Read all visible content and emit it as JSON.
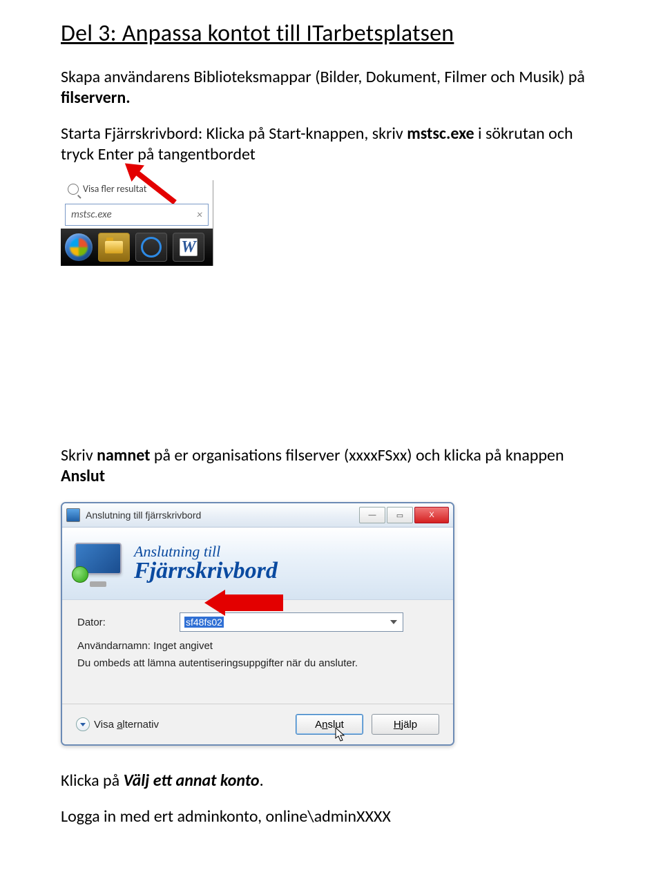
{
  "heading": "Del 3: Anpassa kontot till ITarbetsplatsen",
  "intro": {
    "pre": "Skapa användarens Biblioteksmappar (Bilder, Dokument, Filmer och Musik) på",
    "bold": "filservern."
  },
  "para2": {
    "pre": "Starta Fjärrskrivbord: Klicka på Start-knappen, skriv ",
    "cmd": "mstsc.exe",
    "post": " i sökrutan och tryck Enter på tangentbordet"
  },
  "start_menu": {
    "more_results": "Visa fler resultat",
    "search_value": "mstsc.exe",
    "clear": "×"
  },
  "para3": {
    "pre": "Skriv ",
    "b1": "namnet",
    "mid": " på er organisations filserver (xxxxFSxx) och klicka på knappen ",
    "b2": "Anslut"
  },
  "rdc": {
    "title": "Anslutning till fjärrskrivbord",
    "banner_line1": "Anslutning till",
    "banner_line2": "Fjärrskrivbord",
    "dator_label": "Dator:",
    "dator_value": "sf48fs02",
    "user_label": "Användarnamn:",
    "user_value": "Inget angivet",
    "hint": "Du ombeds att lämna autentiseringsuppgifter när du ansluter.",
    "show_options": "Visa alternativ",
    "connect": "Anslut",
    "help": "Hjälp",
    "min": "—",
    "max": "▭",
    "close": "X"
  },
  "para4": {
    "pre": "Klicka på ",
    "b": "Välj ett annat konto",
    "post": "."
  },
  "para5": "Logga in med ert adminkonto, online\\adminXXXX"
}
